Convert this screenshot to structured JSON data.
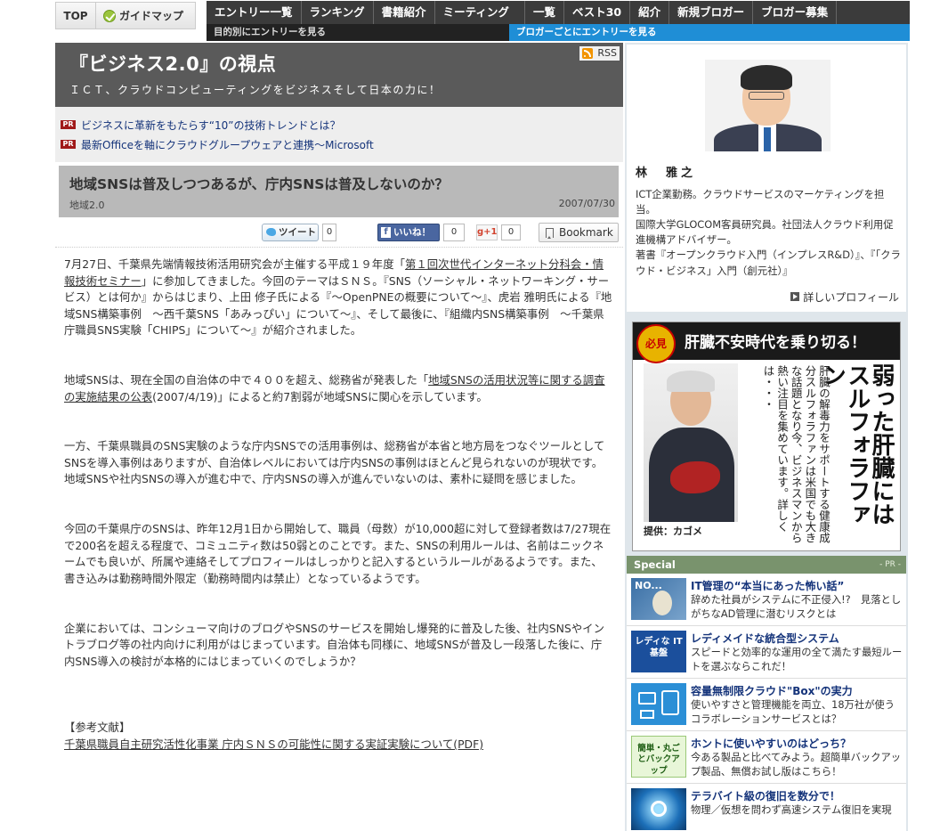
{
  "topnav": {
    "top_label": "TOP",
    "guide_label": "ガイドマップ",
    "items": [
      "エントリー一覧",
      "ランキング",
      "書籍紹介",
      "ミーティング",
      "一覧",
      "ベスト30",
      "紹介",
      "新規ブロガー",
      "ブロガー募集"
    ],
    "sub_left": "目的別にエントリーを見る",
    "sub_right": "ブロガーごとにエントリーを見る"
  },
  "blog": {
    "title": "『ビジネス2.0』の視点",
    "subtitle": "ＩＣＴ、クラウドコンピューティングをビジネスそして日本の力に！",
    "rss_label": "RSS"
  },
  "pr": {
    "badge": "PR",
    "links": [
      "ビジネスに革新をもたらす“10”の技術トレンドとは？",
      "最新Officeを軸にクラウドグループウェアと連携〜Microsoft"
    ]
  },
  "article": {
    "title": "地域SNSは普及しつつあるが、庁内SNSは普及しないのか？",
    "category": "地域2.0",
    "date": "2007/07/30",
    "social": {
      "tweet_label": "ツイート",
      "tweet_count": "0",
      "like_label": "いいね！",
      "like_count": "0",
      "gplus_label": "g+1",
      "gplus_count": "0",
      "bookmark_label": "Bookmark"
    },
    "p1_a": "7月27日、千葉県先端情報技術活用研究会が主催する平成１９年度「",
    "p1_link": "第１回次世代インターネット分科会・情報技術セミナー",
    "p1_b": "」に参加してきました。今回のテーマはＳＮＳ。『SNS（ソーシャル・ネットワーキング・サービス）とは何か』からはじまり、上田 修子氏による『〜OpenPNEの概要について〜』、虎岩 雅明氏による『地域SNS構築事例　〜西千葉SNS「あみっぴい」について〜』、そして最後に、『組織内SNS構築事例　〜千葉県庁職員SNS実験「CHIPS」について〜』が紹介されました。",
    "p2_a": "地域SNSは、現在全国の自治体の中で４００を超え、総務省が発表した「",
    "p2_link": "地域SNSの活用状況等に関する調査の実施結果の公表",
    "p2_b": "(2007/4/19)」によると約7割弱が地域SNSに関心を示しています。",
    "p3": "一方、千葉県職員のSNS実験のような庁内SNSでの活用事例は、総務省が本省と地方局をつなぐツールとしてSNSを導入事例はありますが、自治体レベルにおいては庁内SNSの事例はほとんど見られないのが現状です。地域SNSや社内SNSの導入が進む中で、庁内SNSの導入が進んでいないのは、素朴に疑問を感じました。",
    "p4": "今回の千葉県庁のSNSは、昨年12月1日から開始して、職員（母数）が10,000超に対して登録者数は7/27現在で200名を超える程度で、コミュニティ数は50弱とのことです。また、SNSの利用ルールは、名前はニックネームでも良いが、所属や連絡そしてプロフィールはしっかりと記入するというルールがあるようです。また、書き込みは勤務時間外限定（勤務時間内は禁止）となっているようです。",
    "p5": "企業においては、コンシューマ向けのブログやSNSのサービスを開始し爆発的に普及した後、社内SNSやイントラブログ等の社内向けに利用がはじまっています。自治体も同様に、地域SNSが普及し一段落した後に、庁内SNS導入の検討が本格的にはじまっていくのでしょうか？",
    "refs_title": "【参考文献】",
    "ref_link": "千葉県職員自主研究活性化事業 庁内ＳＮＳの可能性に関する実証実験について(PDF)"
  },
  "profile": {
    "name": "林　雅之",
    "bio": [
      "ICT企業勤務。クラウドサービスのマーケティングを担当。",
      "国際大学GLOCOM客員研究員。社団法人クラウド利用促進機構アドバイザー。",
      "著書『オープンクラウド入門（インプレスR&D）』、『「クラウド・ビジネス」入門（創元社）』"
    ],
    "more_label": "詳しいプロフィール"
  },
  "ad": {
    "badge": "必見",
    "headline": "肝臓不安時代を乗り切る！",
    "big_copy": "弱った肝臓にはスルフォラファン",
    "body_copy": "肝臓の解毒力をサポートする健康成分スルフォラファンは米国でも大きな話題となり今、ビジネスマンから熱い注目を集めています。詳しくは・・・",
    "credit": "提供：カゴメ"
  },
  "special": {
    "heading": "Special",
    "pr_label": "- PR -",
    "items": [
      {
        "title": "IT管理の“本当にあった怖い話”",
        "desc": "辞めた社員がシステムに不正侵入!?　見落としがちなAD管理に潜むリスクとは",
        "thumb_text": "NO..."
      },
      {
        "title": "レディメイドな統合型システム",
        "desc": "スピードと効率的な運用の全て満たす最短ルートを選ぶならこれだ！",
        "thumb_text": "レディな IT基盤"
      },
      {
        "title": "容量無制限クラウド\"Box\"の実力",
        "desc": "使いやすさと管理機能を両立、18万社が使うコラボレーションサービスとは？",
        "thumb_text": ""
      },
      {
        "title": "ホントに使いやすいのはどっち？",
        "desc": "今ある製品と比べてみよう。超簡単バックアップ製品、無償お試し版はこちら！",
        "thumb_text": "簡単・丸ごとバックアップ"
      },
      {
        "title": "テラバイト級の復旧を数分で！",
        "desc": "物理／仮想を問わず高速システム復旧を実現",
        "thumb_text": ""
      }
    ]
  },
  "colors": {
    "nav_bg": "#3b3b3b",
    "sub_blue": "#1f8ed6",
    "header_bg": "#5a5a5a",
    "link_blue": "#14337a",
    "special_green": "#79936d"
  }
}
